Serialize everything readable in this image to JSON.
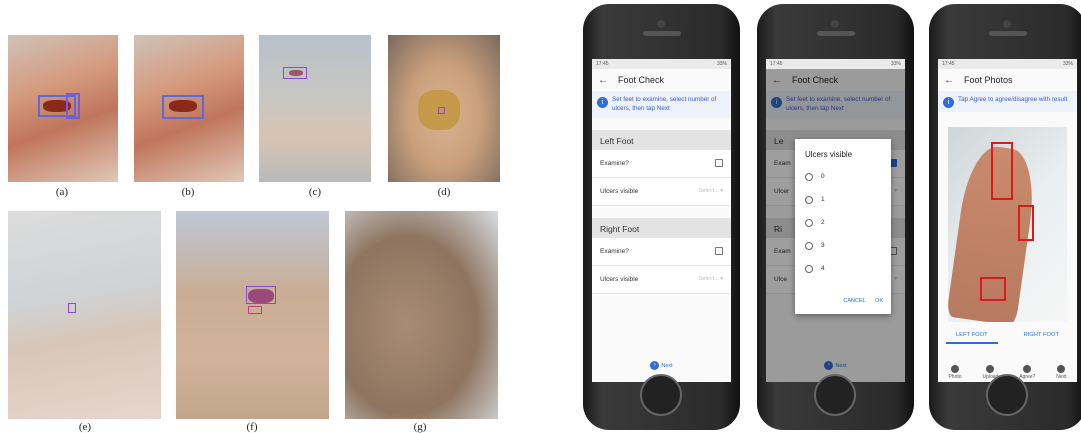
{
  "captions": [
    "(a)",
    "(b)",
    "(c)",
    "(d)",
    "(e)",
    "(f)",
    "(g)"
  ],
  "phone1": {
    "status_time": "17:45",
    "status_right": "33%",
    "title": "Foot Check",
    "back_icon": "arrow-left-icon",
    "info_text": "Set feet to examine, select number of ulcers, then tap Next",
    "left_section": "Left Foot",
    "right_section": "Right Foot",
    "examine_label": "Examine?",
    "ulcers_label": "Ulcers visible",
    "select_placeholder": "Select...",
    "next_label": "Next"
  },
  "phone2": {
    "status_time": "17:45",
    "status_right": "33%",
    "title": "Foot Check",
    "info_text": "Set feet to examine, select number of ulcers, then tap Next",
    "left_section_partial": "Le",
    "right_section_partial": "Ri",
    "examine_partial": "Exam",
    "ulcers_partial": "Ulcer",
    "ulcers_partial2": "Ulce",
    "dialog_title": "Ulcers visible",
    "options": [
      "0",
      "1",
      "2",
      "3",
      "4"
    ],
    "cancel_label": "CANCEL",
    "ok_label": "OK",
    "next_label": "Next"
  },
  "phone3": {
    "status_time": "17:45",
    "status_right": "33%",
    "title": "Foot Photos",
    "info_text": "Tap Agree to agree/disagree with result",
    "tab_left": "LEFT FOOT",
    "tab_right": "RIGHT FOOT",
    "nav": [
      "Photo",
      "Upload",
      "Agree?",
      "Next"
    ]
  },
  "colors": {
    "accent": "#2e6fd6",
    "bbox_red": "#d81b1b",
    "bbox_blue": "#5a6bd8"
  }
}
